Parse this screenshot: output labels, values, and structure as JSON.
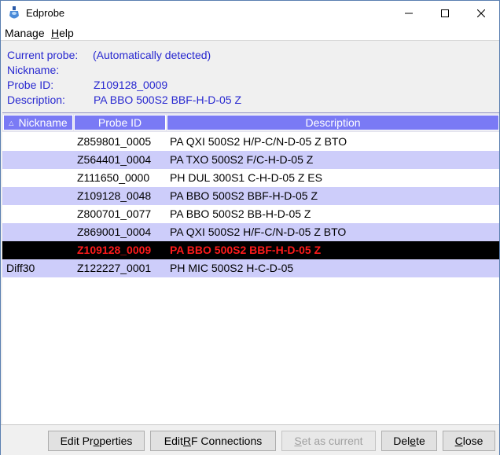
{
  "window": {
    "title": "Edprobe"
  },
  "menu": [
    {
      "pre": "M",
      "ul": "",
      "post": "anage"
    },
    {
      "pre": "",
      "ul": "H",
      "post": "elp"
    }
  ],
  "info": {
    "current_probe_label": "Current probe:",
    "current_probe_value": "(Automatically detected)",
    "nickname_label": "Nickname:",
    "nickname_value": "",
    "probe_id_label": "Probe ID:",
    "probe_id_value": "Z109128_0009",
    "description_label": "Description:",
    "description_value": "PA BBO 500S2 BBF-H-D-05 Z"
  },
  "table": {
    "columns": [
      "Nickname",
      "Probe ID",
      "Description"
    ],
    "rows": [
      {
        "nickname": "",
        "probe_id": "Z859801_0005",
        "description": "PA QXI 500S2 H/P-C/N-D-05 Z BTO"
      },
      {
        "nickname": "",
        "probe_id": "Z564401_0004",
        "description": "PA TXO 500S2 F/C-H-D-05 Z"
      },
      {
        "nickname": "",
        "probe_id": "Z111650_0000",
        "description": "PH DUL 300S1 C-H-D-05 Z ES"
      },
      {
        "nickname": "",
        "probe_id": "Z109128_0048",
        "description": "PA BBO 500S2 BBF-H-D-05 Z"
      },
      {
        "nickname": "",
        "probe_id": "Z800701_0077",
        "description": "PA BBO 500S2 BB-H-D-05 Z"
      },
      {
        "nickname": "",
        "probe_id": "Z869001_0004",
        "description": "PA QXI 500S2 H/F-C/N-D-05 Z BTO"
      },
      {
        "nickname": "",
        "probe_id": "Z109128_0009",
        "description": "PA BBO 500S2 BBF-H-D-05 Z"
      },
      {
        "nickname": "Diff30",
        "probe_id": "Z122227_0001",
        "description": "PH MIC 500S2 H-C-D-05"
      }
    ]
  },
  "buttons": {
    "edit_properties": {
      "pre": "Edit Pr",
      "ul": "o",
      "post": "perties"
    },
    "edit_rf": {
      "pre": "Edit ",
      "ul": "R",
      "post": "F Connections"
    },
    "set_current": {
      "pre": "",
      "ul": "S",
      "post": "et as current"
    },
    "delete": {
      "pre": "Del",
      "ul": "e",
      "post": "te"
    },
    "close": {
      "pre": "",
      "ul": "C",
      "post": "lose"
    }
  },
  "colors": {
    "info_text": "#2828d0",
    "header_bg": "#7a7af5",
    "row_alt": "#cdcdfa",
    "selected_bg": "#000000",
    "selected_text": "#ff1a1a"
  }
}
